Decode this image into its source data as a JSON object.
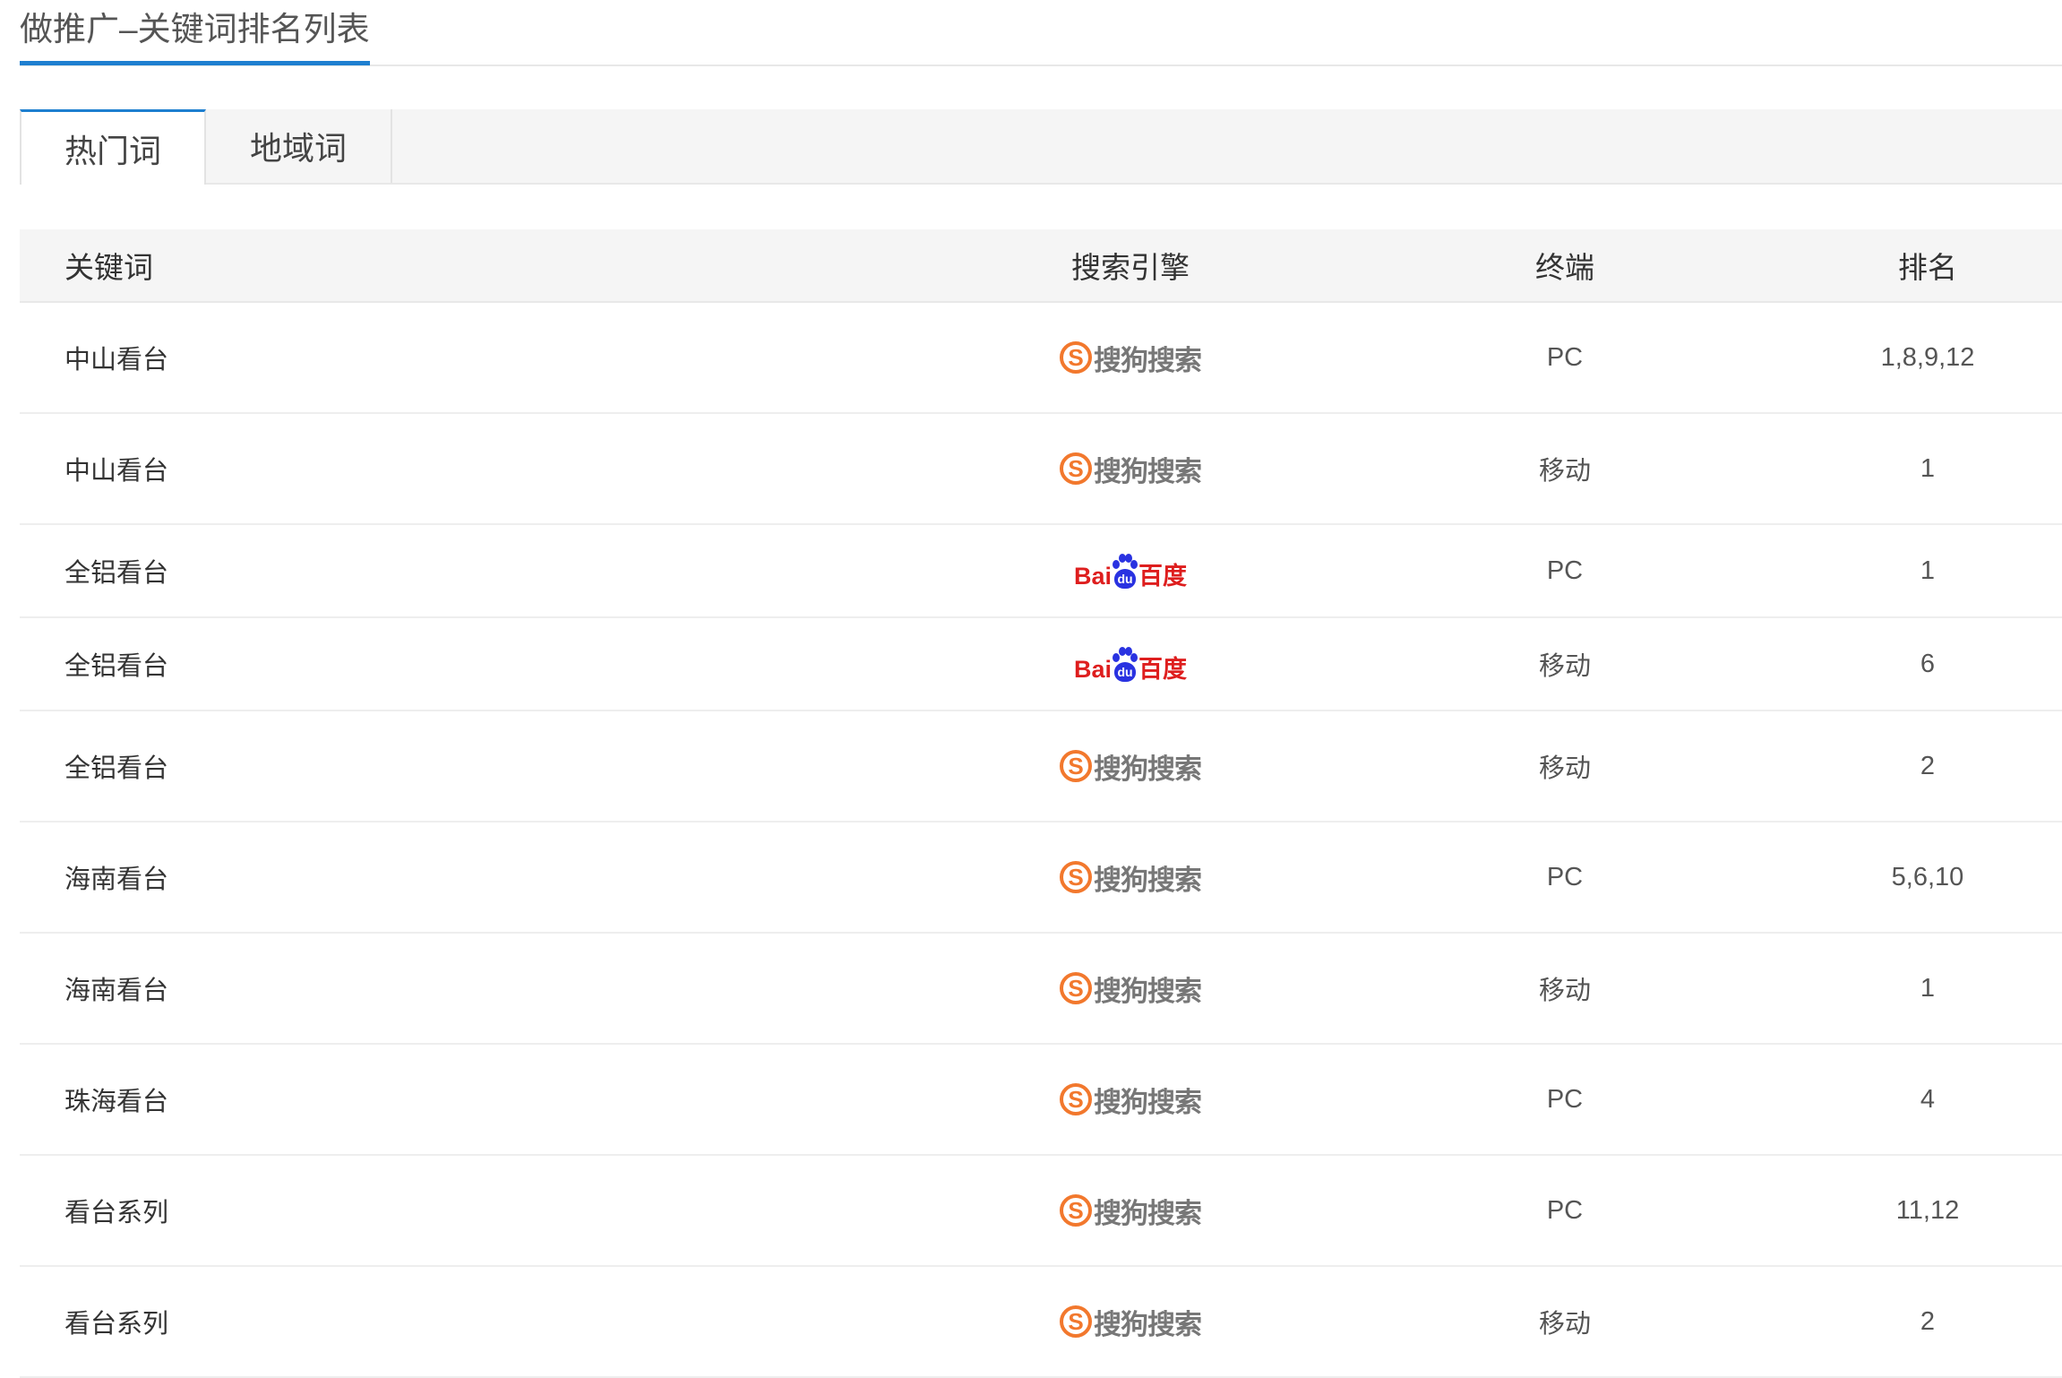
{
  "header": {
    "title": "做推广–关键词排名列表"
  },
  "tabs": [
    {
      "label": "热门词",
      "active": true
    },
    {
      "label": "地域词",
      "active": false
    }
  ],
  "table": {
    "columns": {
      "keyword": "关键词",
      "engine": "搜索引擎",
      "terminal": "终端",
      "rank": "排名"
    },
    "rows": [
      {
        "keyword": "中山看台",
        "engine": "sogou",
        "terminal": "PC",
        "rank": "1,8,9,12"
      },
      {
        "keyword": "中山看台",
        "engine": "sogou",
        "terminal": "移动",
        "rank": "1"
      },
      {
        "keyword": "全铝看台",
        "engine": "baidu",
        "terminal": "PC",
        "rank": "1"
      },
      {
        "keyword": "全铝看台",
        "engine": "baidu",
        "terminal": "移动",
        "rank": "6"
      },
      {
        "keyword": "全铝看台",
        "engine": "sogou",
        "terminal": "移动",
        "rank": "2"
      },
      {
        "keyword": "海南看台",
        "engine": "sogou",
        "terminal": "PC",
        "rank": "5,6,10"
      },
      {
        "keyword": "海南看台",
        "engine": "sogou",
        "terminal": "移动",
        "rank": "1"
      },
      {
        "keyword": "珠海看台",
        "engine": "sogou",
        "terminal": "PC",
        "rank": "4"
      },
      {
        "keyword": "看台系列",
        "engine": "sogou",
        "terminal": "PC",
        "rank": "11,12"
      },
      {
        "keyword": "看台系列",
        "engine": "sogou",
        "terminal": "移动",
        "rank": "2"
      }
    ]
  },
  "logos": {
    "sogou": {
      "mark": "S",
      "text": "搜狗搜索",
      "color": "#f2782d"
    },
    "baidu": {
      "part1": "Bai",
      "paw": "du",
      "part2": "百度",
      "red": "#de1e1e",
      "blue": "#2932e1"
    }
  },
  "colors": {
    "accent": "#1e7fd0",
    "header_bg": "#f5f5f5"
  }
}
